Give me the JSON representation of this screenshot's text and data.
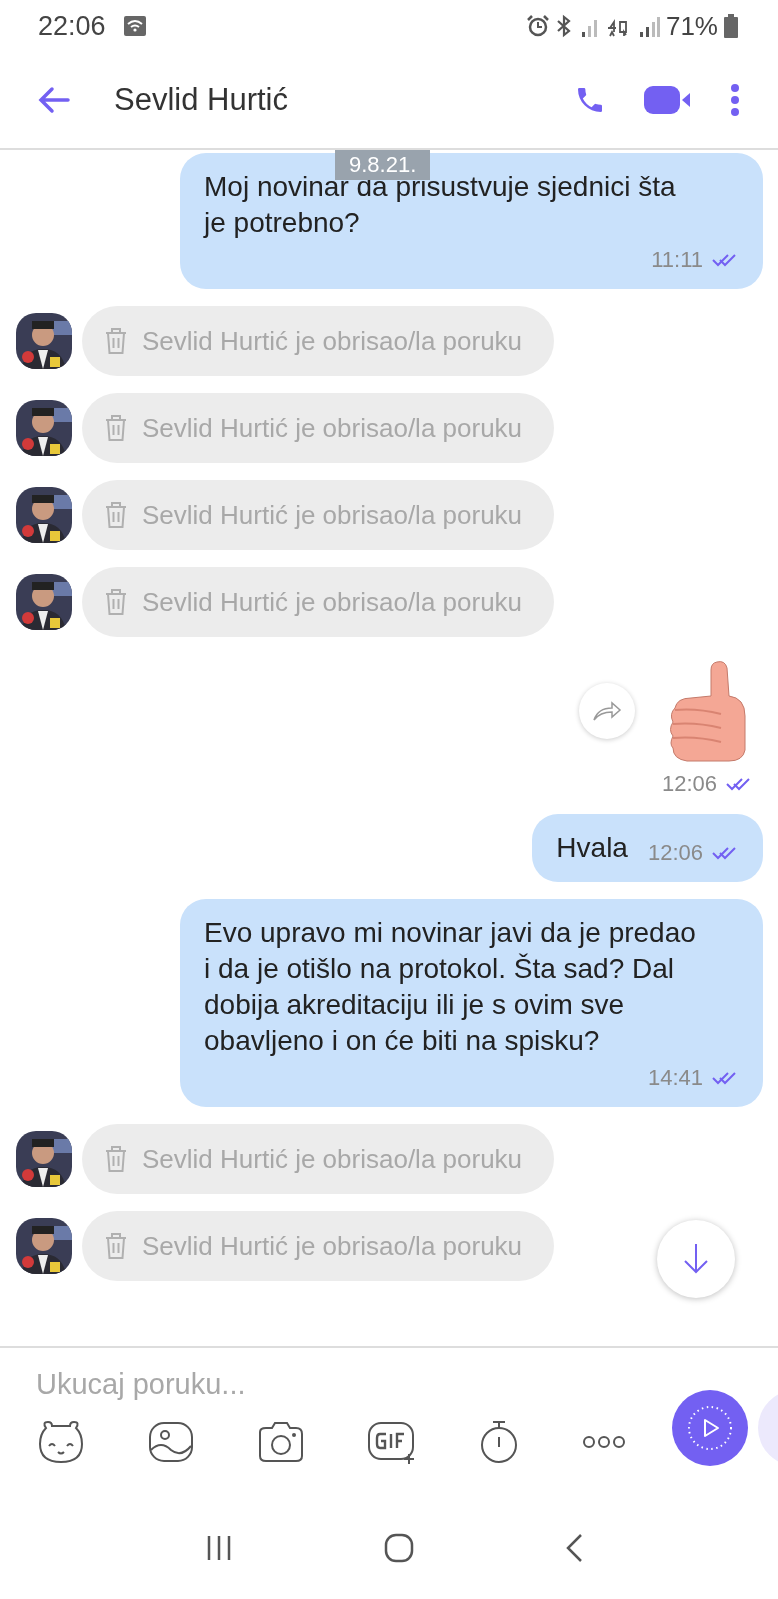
{
  "status_bar": {
    "time": "22:06",
    "battery": "71%"
  },
  "header": {
    "title": "Sevlid Hurtić"
  },
  "date_badge": "9.8.21.",
  "messages": [
    {
      "kind": "outgoing",
      "text": "Moj novinar da prisustvuje sjednici šta je potrebno?",
      "time": "11:11",
      "seen": true
    },
    {
      "kind": "deleted",
      "text": "Sevlid Hurtić je obrisao/la poruku"
    },
    {
      "kind": "deleted",
      "text": "Sevlid Hurtić je obrisao/la poruku"
    },
    {
      "kind": "deleted",
      "text": "Sevlid Hurtić je obrisao/la poruku"
    },
    {
      "kind": "deleted",
      "text": "Sevlid Hurtić je obrisao/la poruku"
    },
    {
      "kind": "sticker",
      "time": "12:06",
      "seen": true
    },
    {
      "kind": "outgoing",
      "text": "Hvala",
      "time": "12:06",
      "seen": true
    },
    {
      "kind": "outgoing",
      "text": "Evo upravo mi novinar javi da je predao i da je otišlo na protokol. Šta sad? Dal dobija akreditaciju ili je s ovim sve obavljeno i on će biti na spisku?",
      "time": "14:41",
      "seen": true
    },
    {
      "kind": "deleted",
      "text": "Sevlid Hurtić je obrisao/la poruku"
    },
    {
      "kind": "deleted",
      "text": "Sevlid Hurtić je obrisao/la poruku"
    }
  ],
  "composer": {
    "placeholder": "Ukucaj poruku..."
  }
}
